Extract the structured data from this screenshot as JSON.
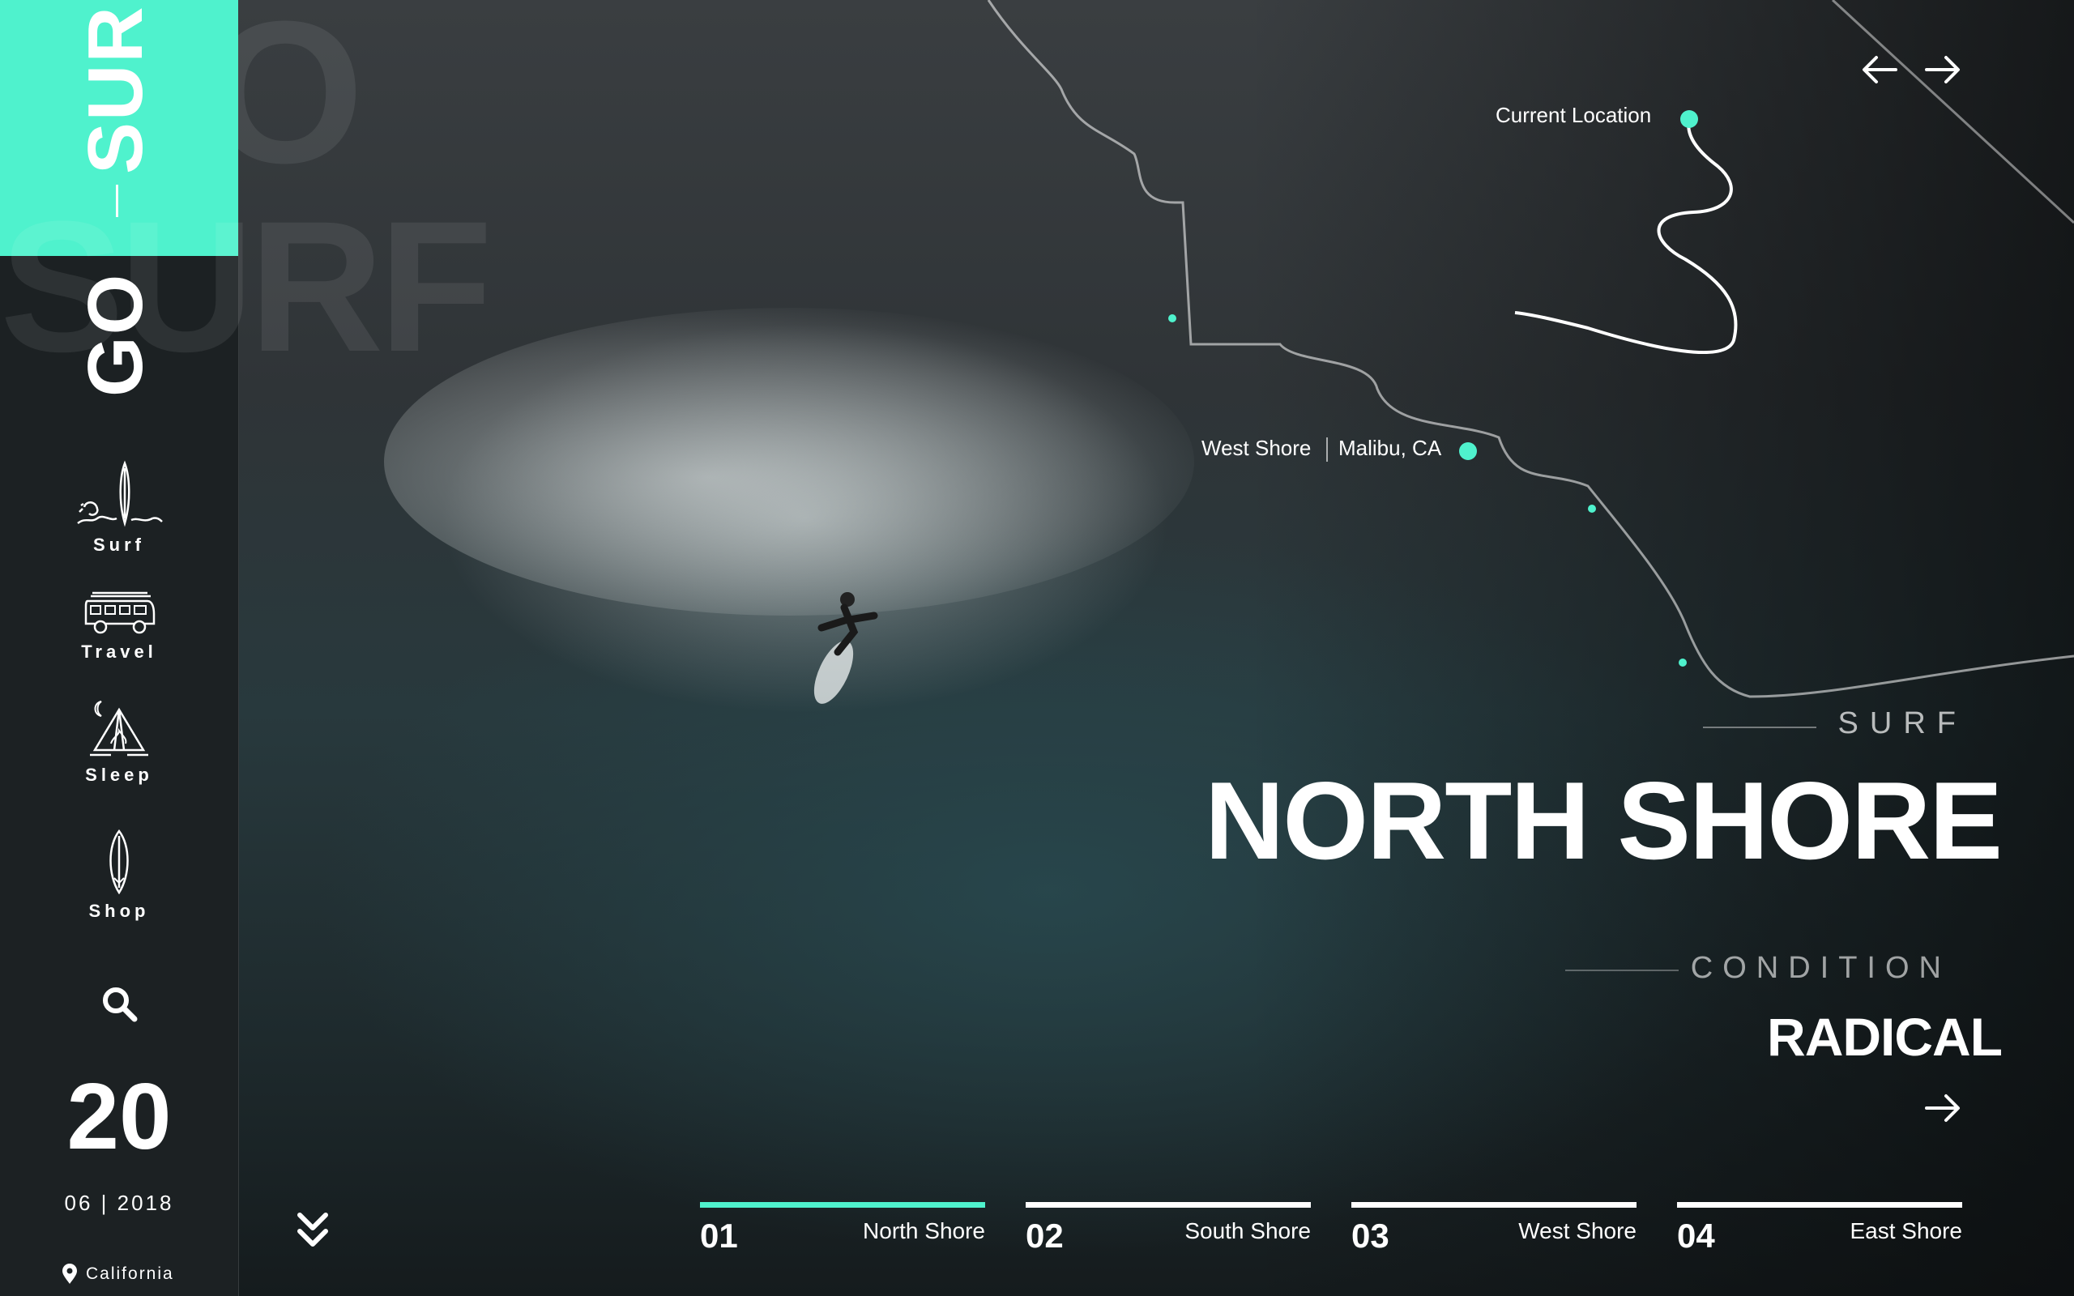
{
  "brand": {
    "go": "GO",
    "surf": "SURF",
    "ghost_text": "SURF",
    "ghost_o": "O",
    "accent_color": "#4ff2cd"
  },
  "nav": [
    {
      "label": "Surf",
      "icon": "surfboard-wave-icon"
    },
    {
      "label": "Travel",
      "icon": "van-icon"
    },
    {
      "label": "Sleep",
      "icon": "tent-moon-icon"
    },
    {
      "label": "Shop",
      "icon": "surfboard-icon"
    }
  ],
  "search": {
    "icon": "search-icon"
  },
  "date": {
    "day": "20",
    "month_year": "06 | 2018"
  },
  "location": {
    "icon": "pin-icon",
    "label": "California"
  },
  "header_nav": {
    "prev_icon": "arrow-left-icon",
    "next_icon": "arrow-right-icon"
  },
  "map": {
    "current_location": "Current Location",
    "spot_label": "West Shore",
    "spot_sub": "Malibu, CA"
  },
  "feature": {
    "category": "SURF",
    "title": "NORTH SHORE",
    "condition_label": "CONDITION",
    "condition_value": "RADICAL",
    "go_icon": "arrow-right-icon"
  },
  "scroll_icon": "chevrons-down-icon",
  "tabs": [
    {
      "num": "01",
      "name": "North Shore",
      "active": true
    },
    {
      "num": "02",
      "name": "South Shore",
      "active": false
    },
    {
      "num": "03",
      "name": "West Shore",
      "active": false
    },
    {
      "num": "04",
      "name": "East Shore",
      "active": false
    }
  ]
}
